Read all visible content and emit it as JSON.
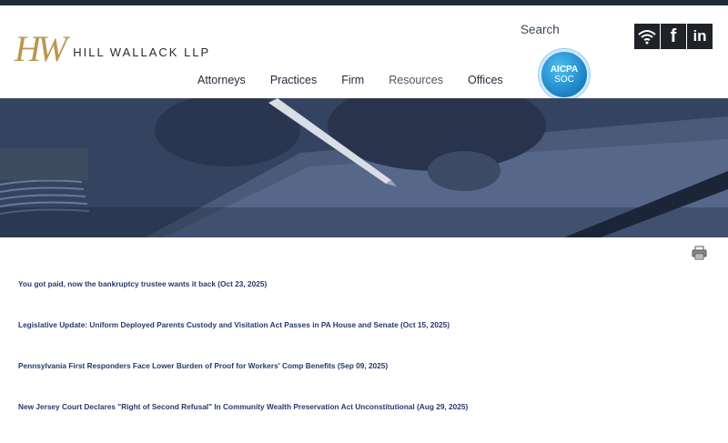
{
  "header": {
    "logo_mark": "HW",
    "logo_text": "HILL WALLACK LLP",
    "search_label": "Search",
    "badge": {
      "line1": "AICPA",
      "line2": "SOC"
    },
    "social": [
      "rss-icon",
      "facebook-icon",
      "linkedin-icon"
    ],
    "facebook_glyph": "f",
    "linkedin_glyph": "in"
  },
  "nav": {
    "items": [
      "Attorneys",
      "Practices",
      "Firm",
      "Resources",
      "Offices"
    ]
  },
  "articles": [
    "You got paid, now the bankruptcy trustee wants it back (Oct 23, 2025)",
    "Legislative Update: Uniform Deployed Parents Custody and Visitation Act Passes in PA House and Senate (Oct 15, 2025)",
    "Pennsylvania First Responders Face Lower Burden of Proof for Workers' Comp Benefits (Sep 09, 2025)",
    "New Jersey Court Declares \"Right of Second Refusal\" In Community Wealth Preservation Act Unconstitutional (Aug 29, 2025)"
  ],
  "colors": {
    "topbar": "#1f2a3a",
    "logo_gold": "#b9974f",
    "link_blue": "#243a6b",
    "social_bg": "#1f2328"
  }
}
